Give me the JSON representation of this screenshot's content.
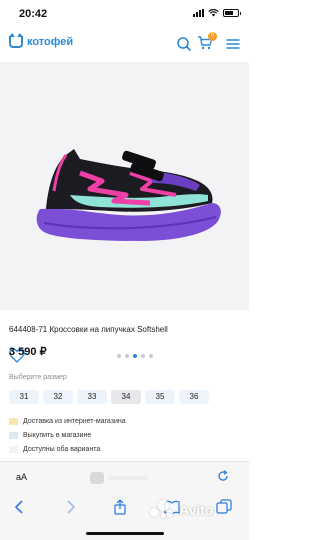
{
  "status_bar": {
    "time": "20:42"
  },
  "header": {
    "brand": "котофей",
    "cart_count": "0"
  },
  "gallery": {
    "slides": 5,
    "active_slide": 2
  },
  "product": {
    "title": "644408-71 Кроссовки на липучках Softshell",
    "price": "3 590 ₽"
  },
  "sizes": {
    "label": "Выберите размер",
    "options": [
      "31",
      "32",
      "33",
      "34",
      "35",
      "36"
    ],
    "selected": "34"
  },
  "delivery": [
    {
      "text": "Доставка из интернет-магазина",
      "color": "#f7e8b0"
    },
    {
      "text": "Выкупить в магазине",
      "color": "#dbe9f7"
    },
    {
      "text": "Доступны оба варианта",
      "color": "#f2f2f2"
    }
  ],
  "browser": {
    "aa_label": "aA"
  },
  "watermark": {
    "text": "Avito"
  },
  "colors": {
    "accent": "#2b8ad8",
    "badge": "#f29d25"
  }
}
